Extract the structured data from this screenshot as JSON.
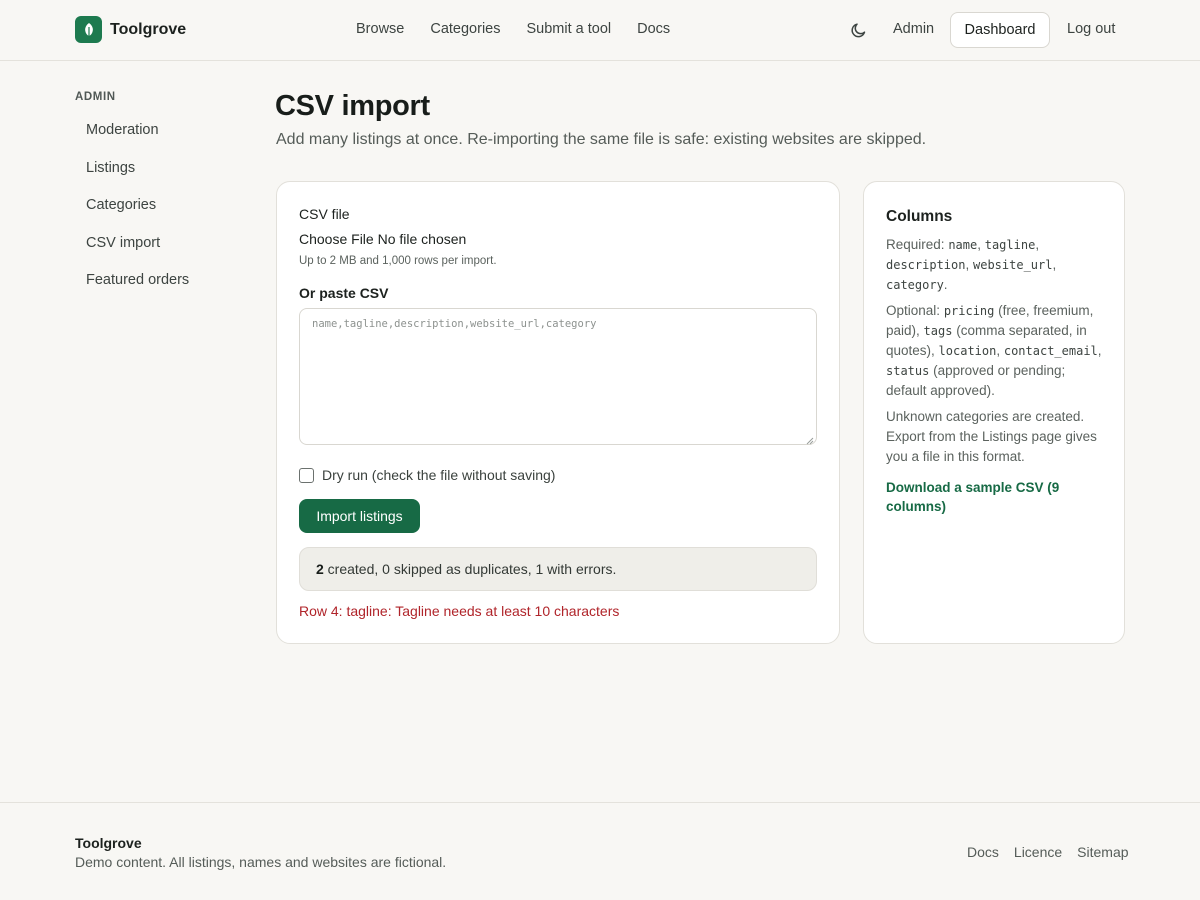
{
  "header": {
    "brand": "Toolgrove",
    "nav": [
      "Browse",
      "Categories",
      "Submit a tool",
      "Docs"
    ],
    "admin": "Admin",
    "dashboard": "Dashboard",
    "logout": "Log out"
  },
  "sidebar": {
    "heading": "ADMIN",
    "items": [
      "Moderation",
      "Listings",
      "Categories",
      "CSV import",
      "Featured orders"
    ]
  },
  "page": {
    "title": "CSV import",
    "subtitle": "Add many listings at once. Re-importing the same file is safe: existing websites are skipped."
  },
  "form": {
    "file_label": "CSV file",
    "choose_file": "Choose File",
    "no_file": "No file chosen",
    "hint": "Up to 2 MB and 1,000 rows per import.",
    "paste_label": "Or paste CSV",
    "paste_placeholder": "name,tagline,description,website_url,category",
    "dry_run": "Dry run (check the file without saving)",
    "submit": "Import listings",
    "result_created": "2",
    "result_rest": " created, 0 skipped as duplicates, 1 with errors.",
    "error": "Row 4: tagline: Tagline needs at least 10 characters"
  },
  "columns": {
    "title": "Columns",
    "required_label": "Required:",
    "required": [
      "name",
      "tagline",
      "description",
      "website_url",
      "category"
    ],
    "optional_label": "Optional:",
    "opt_pricing": "pricing",
    "opt_pricing_note": "(free, freemium, paid),",
    "opt_tags": "tags",
    "opt_tags_note": "(comma separated, in quotes),",
    "opt_location": "location",
    "opt_email": "contact_email",
    "opt_status": "status",
    "opt_status_note": "(approved or pending; default approved).",
    "note": "Unknown categories are created. Export from the Listings page gives you a file in this format.",
    "sample_link": "Download a sample CSV (9 columns)"
  },
  "footer": {
    "brand": "Toolgrove",
    "note": "Demo content. All listings, names and websites are fictional.",
    "links": [
      "Docs",
      "Licence",
      "Sitemap"
    ]
  },
  "colors": {
    "accent": "#176a45",
    "brand_mark": "#1d7a4f",
    "error": "#b0242a",
    "background": "#f8f7f4"
  },
  "icons": [
    "leaf-icon",
    "moon-icon",
    "resize-grip-icon"
  ]
}
